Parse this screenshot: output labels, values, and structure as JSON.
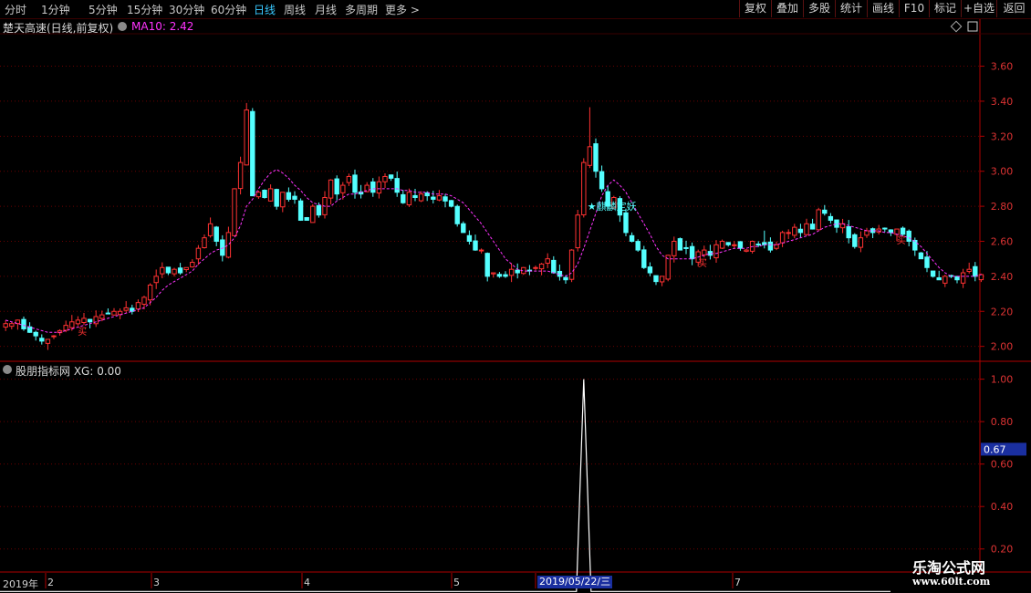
{
  "toolbar": {
    "periods": [
      "分时",
      "1分钟",
      "5分钟",
      "15分钟",
      "30分钟",
      "60分钟",
      "日线",
      "周线",
      "月线",
      "多周期",
      "更多 >"
    ],
    "active_period": "日线",
    "right_buttons": [
      "复权",
      "叠加",
      "多股",
      "统计",
      "画线",
      "F10",
      "标记",
      "+自选",
      "返回"
    ]
  },
  "stock": {
    "title": "楚天高速(日线,前复权)",
    "ma_label": "MA10: 2.42"
  },
  "indicator": {
    "label": "股朋指标网  XG: 0.00",
    "cursor_value": "0.67"
  },
  "annotations": {
    "signal_text": "麒麟定妖",
    "buy_text": "买"
  },
  "time_axis": {
    "year_label": "2019年",
    "months": [
      "2",
      "3",
      "4",
      "5",
      "7"
    ],
    "highlight_date": "2019/05/22/三"
  },
  "watermark": {
    "line1": "乐淘公式网",
    "line2": "www.60lt.com"
  },
  "colors": {
    "up": "#ff3232",
    "down": "#54ffff",
    "ma": "#ff33ff",
    "signal_line": "#ffffff",
    "axis": "#b00000",
    "grid": "#6a0000"
  },
  "chart_data": [
    {
      "type": "candlestick",
      "title": "楚天高速(日线,前复权)",
      "ylim": [
        1.92,
        3.78
      ],
      "y_ticks": [
        2.0,
        2.2,
        2.4,
        2.6,
        2.8,
        3.0,
        3.2,
        3.4,
        3.6
      ],
      "close": [
        2.13,
        2.13,
        2.15,
        2.1,
        2.08,
        2.06,
        2.03,
        2.04,
        2.06,
        2.09,
        2.12,
        2.14,
        2.15,
        2.16,
        2.14,
        2.17,
        2.18,
        2.19,
        2.2,
        2.2,
        2.22,
        2.2,
        2.25,
        2.28,
        2.35,
        2.4,
        2.45,
        2.42,
        2.44,
        2.42,
        2.45,
        2.48,
        2.56,
        2.62,
        2.7,
        2.6,
        2.52,
        2.65,
        2.9,
        3.05,
        3.35,
        2.86,
        2.88,
        2.85,
        2.9,
        2.8,
        2.88,
        2.84,
        2.84,
        2.72,
        2.72,
        2.8,
        2.75,
        2.85,
        2.95,
        2.87,
        2.92,
        2.97,
        2.88,
        2.87,
        2.92,
        2.88,
        2.94,
        2.97,
        2.96,
        2.88,
        2.82,
        2.88,
        2.85,
        2.87,
        2.86,
        2.84,
        2.86,
        2.83,
        2.8,
        2.7,
        2.65,
        2.6,
        2.55,
        2.55,
        2.4,
        2.42,
        2.4,
        2.4,
        2.44,
        2.42,
        2.45,
        2.43,
        2.45,
        2.47,
        2.5,
        2.42,
        2.4,
        2.38,
        2.55,
        2.75,
        3.05,
        3.14,
        3.0,
        2.9,
        2.8,
        2.85,
        2.75,
        2.65,
        2.6,
        2.55,
        2.45,
        2.42,
        2.37,
        2.4,
        2.52,
        2.6,
        2.55,
        2.56,
        2.5,
        2.54,
        2.55,
        2.52,
        2.58,
        2.6,
        2.58,
        2.58,
        2.56,
        2.55,
        2.6,
        2.58,
        2.58,
        2.55,
        2.58,
        2.65,
        2.65,
        2.68,
        2.65,
        2.7,
        2.67,
        2.78,
        2.76,
        2.72,
        2.68,
        2.7,
        2.62,
        2.57,
        2.62,
        2.66,
        2.65,
        2.67,
        2.67,
        2.65,
        2.67,
        2.64,
        2.6,
        2.55,
        2.5,
        2.45,
        2.4,
        2.38,
        2.4,
        2.4,
        2.38,
        2.42,
        2.44,
        2.4,
        2.41
      ],
      "series": [
        {
          "name": "MA10",
          "values": [
            2.15,
            2.14,
            2.13,
            2.12,
            2.11,
            2.1,
            2.09,
            2.08,
            2.08,
            2.08,
            2.09,
            2.1,
            2.11,
            2.12,
            2.13,
            2.14,
            2.15,
            2.16,
            2.17,
            2.18,
            2.19,
            2.2,
            2.21,
            2.22,
            2.25,
            2.28,
            2.32,
            2.35,
            2.37,
            2.39,
            2.41,
            2.43,
            2.47,
            2.5,
            2.53,
            2.55,
            2.56,
            2.58,
            2.62,
            2.69,
            2.8,
            2.84,
            2.9,
            2.95,
            2.99,
            3.01,
            2.99,
            2.96,
            2.92,
            2.89,
            2.85,
            2.82,
            2.81,
            2.8,
            2.8,
            2.83,
            2.85,
            2.87,
            2.87,
            2.88,
            2.89,
            2.9,
            2.9,
            2.9,
            2.9,
            2.9,
            2.89,
            2.89,
            2.88,
            2.88,
            2.88,
            2.87,
            2.87,
            2.87,
            2.86,
            2.84,
            2.82,
            2.78,
            2.74,
            2.7,
            2.65,
            2.6,
            2.55,
            2.5,
            2.47,
            2.44,
            2.43,
            2.43,
            2.43,
            2.43,
            2.43,
            2.42,
            2.41,
            2.4,
            2.42,
            2.47,
            2.56,
            2.66,
            2.76,
            2.86,
            2.92,
            2.95,
            2.92,
            2.88,
            2.82,
            2.76,
            2.7,
            2.64,
            2.57,
            2.52,
            2.5,
            2.5,
            2.5,
            2.5,
            2.5,
            2.51,
            2.52,
            2.53,
            2.53,
            2.54,
            2.55,
            2.56,
            2.56,
            2.56,
            2.57,
            2.57,
            2.58,
            2.58,
            2.58,
            2.59,
            2.6,
            2.61,
            2.62,
            2.63,
            2.64,
            2.66,
            2.68,
            2.69,
            2.7,
            2.7,
            2.69,
            2.68,
            2.67,
            2.66,
            2.66,
            2.66,
            2.65,
            2.65,
            2.64,
            2.63,
            2.62,
            2.6,
            2.57,
            2.53,
            2.49,
            2.45,
            2.42,
            2.4,
            2.4,
            2.4,
            2.4,
            2.4,
            2.41
          ]
        }
      ]
    },
    {
      "type": "line",
      "title": "股朋指标网 XG",
      "ylim": [
        0.1,
        1.08
      ],
      "y_ticks": [
        0.2,
        0.4,
        0.6,
        0.8,
        1.0
      ],
      "series": [
        {
          "name": "XG",
          "spike_index": 96,
          "spike_value": 1.0,
          "base_value": 0.0
        }
      ]
    }
  ]
}
